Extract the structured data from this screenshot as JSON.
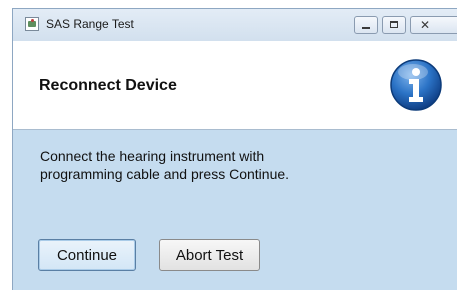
{
  "window": {
    "title": "SAS Range Test",
    "app_icon": "app-window-icon",
    "controls": {
      "minimize_icon": "minimize-icon",
      "maximize_icon": "maximize-icon",
      "close_glyph": "✕"
    }
  },
  "header": {
    "title": "Reconnect Device",
    "icon": "info-icon"
  },
  "message": {
    "line1": "Connect the hearing instrument with",
    "line2": "programming cable and press Continue."
  },
  "buttons": {
    "continue_label": "Continue",
    "abort_label": "Abort Test"
  },
  "colors": {
    "body_background": "#c5dcef",
    "header_background": "#ffffff",
    "info_icon_blue": "#1f64b8"
  }
}
